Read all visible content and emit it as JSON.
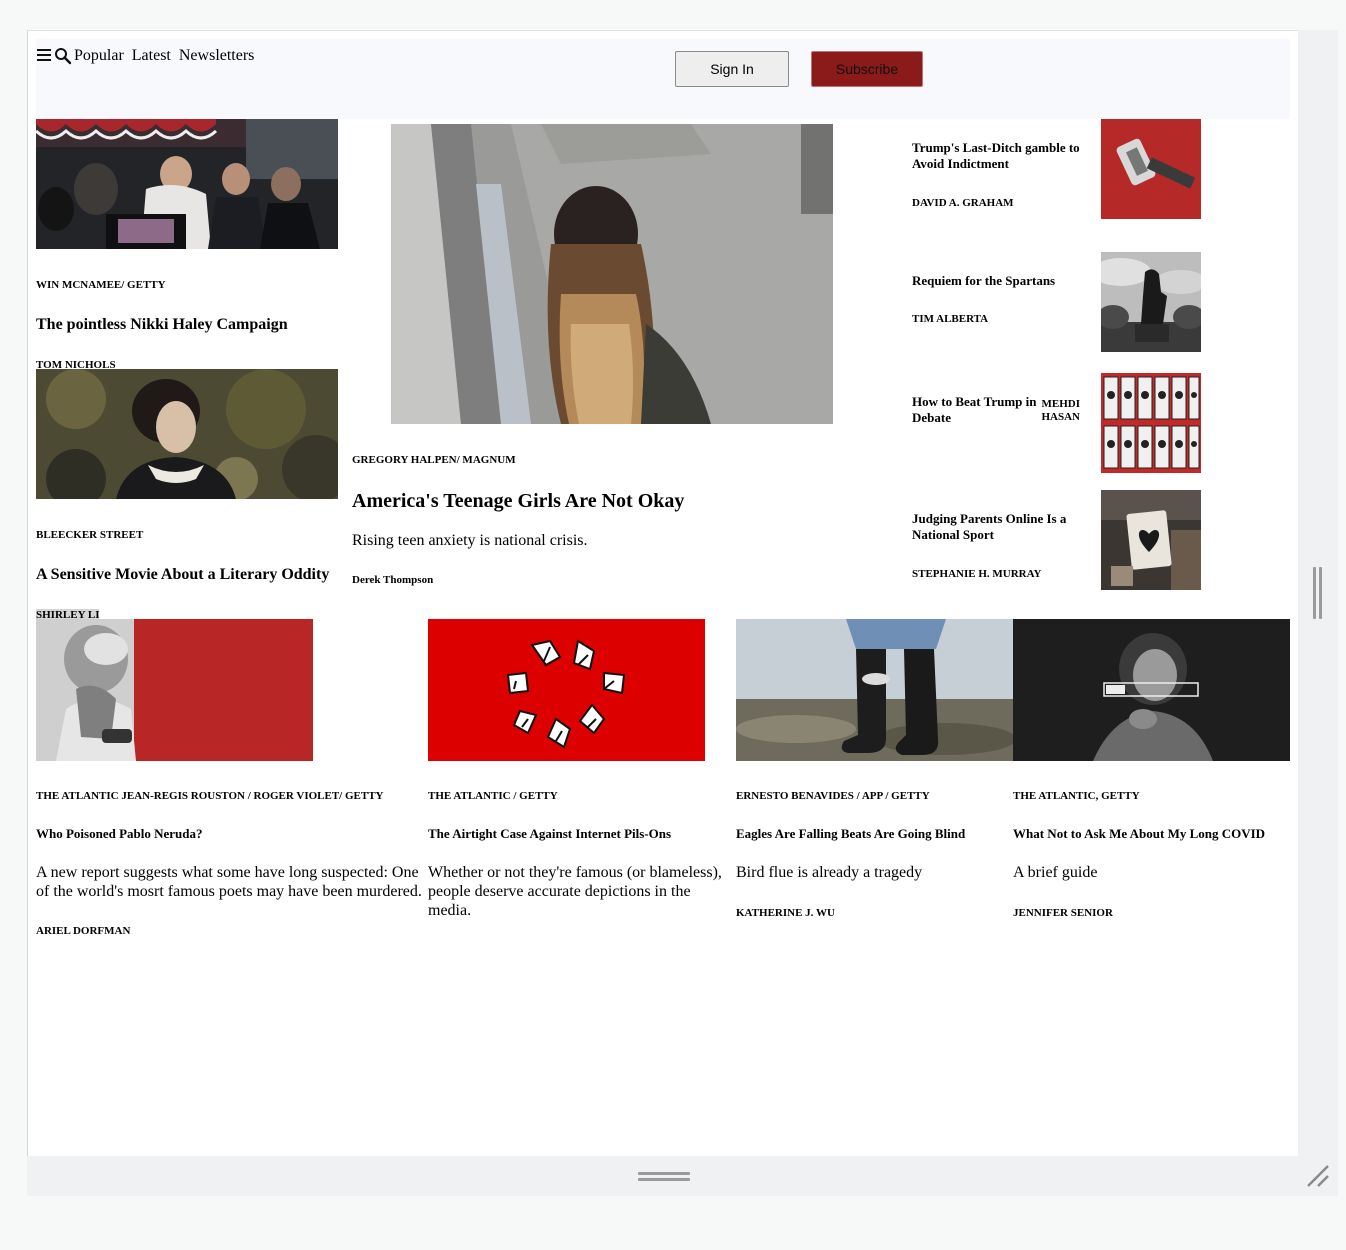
{
  "header": {
    "nav_links": [
      "Popular",
      "Latest",
      "Newsletters"
    ],
    "sign_in_label": "Sign In",
    "subscribe_label": "Subscribe"
  },
  "left_column": [
    {
      "credit": "WIN MCNAMEE/ GETTY",
      "headline": "The pointless Nikki Haley Campaign",
      "byline": "TOM NICHOLS",
      "image_icon": "campaign-crowd-photo"
    },
    {
      "credit": "BLEECKER STREET",
      "headline": "A Sensitive Movie About a Literary Oddity",
      "byline": "SHIRLEY LI",
      "image_icon": "period-drama-woman-photo"
    }
  ],
  "center_feature": {
    "credit": "GREGORY HALPEN/ MAGNUM",
    "headline": "America's Teenage Girls Are Not Okay",
    "dek": "Rising teen anxiety is national crisis.",
    "byline": "Derek Thompson",
    "image_icon": "teenage-girl-photo"
  },
  "right_column": [
    {
      "headline": "Trump's Last-Ditch gamble to Avoid Indictment",
      "byline": "DAVID A. GRAHAM",
      "image_icon": "gavel-illustration"
    },
    {
      "headline": "Requiem for the Spartans",
      "byline": "TIM ALBERTA",
      "image_icon": "spartan-statue-photo"
    },
    {
      "headline": "How to Beat Trump in Debate",
      "byline": "MEHDI HASAN",
      "image_icon": "playing-cards-illustration"
    },
    {
      "headline": "Judging Parents Online Is a National Sport",
      "byline": "STEPHANIE H. MURRAY",
      "image_icon": "heart-card-photo"
    }
  ],
  "bottom_row": [
    {
      "credit": "THE ATLANTIC JEAN-REGIS ROUSTON / ROGER VIOLET/ GETTY",
      "headline": "Who Poisoned Pablo Neruda?",
      "dek": "A new report suggests what some have long suspected: One of the world's mosrt famous poets may have been murdered.",
      "byline": "ARIEL DORFMAN",
      "image_icon": "neruda-portrait-photo"
    },
    {
      "credit": "THE ATLANTIC / GETTY",
      "headline": "The Airtight Case Against Internet Pils-Ons",
      "dek": "Whether or not they're famous (or blameless), people deserve accurate depictions in the media.",
      "byline": "",
      "image_icon": "pointing-hands-illustration"
    },
    {
      "credit": "ERNESTO BENAVIDES / APP / GETTY",
      "headline": "Eagles Are Falling Beats Are Going Blind",
      "dek": "Bird flue is already a tragedy",
      "byline": "KATHERINE J. WU",
      "image_icon": "rubber-boots-photo"
    },
    {
      "credit": "THE ATLANTIC, GETTY",
      "headline": "What Not to Ask Me About My Long COVID",
      "dek": "A brief guide",
      "byline": "JENNIFER SENIOR",
      "image_icon": "loading-bar-woman-photo"
    }
  ],
  "colors": {
    "subscribe_bg": "#8b1a1a",
    "header_bg": "#f8f9fc",
    "accent_red": "#dd0000"
  }
}
